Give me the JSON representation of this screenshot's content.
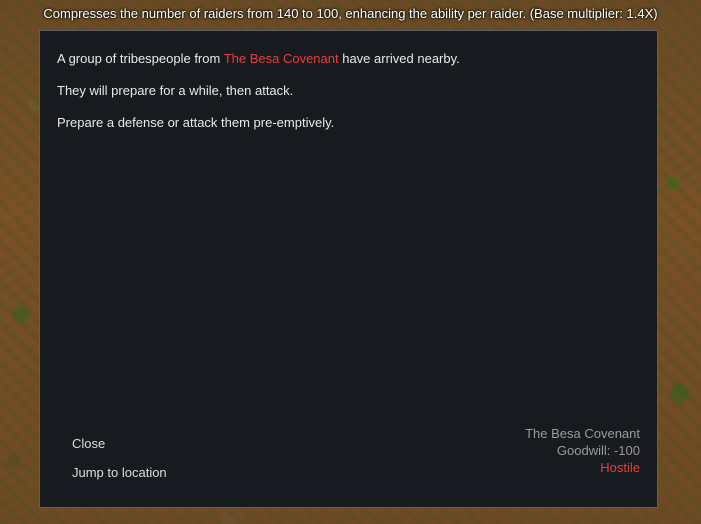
{
  "tooltip": {
    "text": "Compresses the number of raiders from 140 to 100, enhancing the ability per raider. (Base multiplier: 1.4X)"
  },
  "letter": {
    "line1_prefix": "A group of tribespeople from ",
    "line1_faction": "The Besa Covenant",
    "line1_suffix": " have arrived nearby.",
    "line2": "They will prepare for a while, then attack.",
    "line3": "Prepare a defense or attack them pre-emptively."
  },
  "options": {
    "close": "Close",
    "jump": "Jump to location"
  },
  "faction": {
    "name": "The Besa Covenant",
    "goodwill": "Goodwill: -100",
    "status": "Hostile"
  },
  "colors": {
    "hostile": "#ec3d3d",
    "dialog_bg": "#171b1f",
    "border": "#5c6168"
  }
}
